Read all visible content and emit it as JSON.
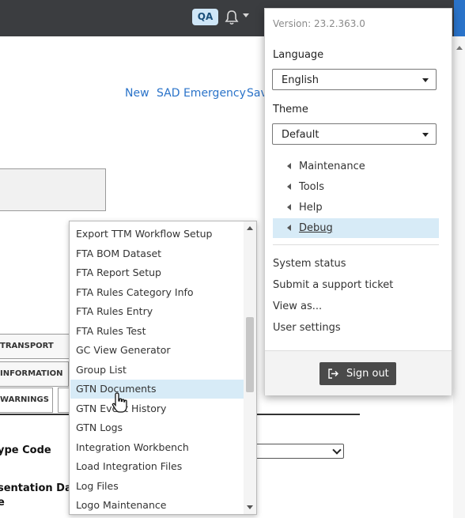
{
  "topbar": {
    "env_badge": "QA"
  },
  "actions": {
    "new": "New",
    "sad_emergency": "SAD Emergency",
    "save_partial": "Sav"
  },
  "background": {
    "tabs": [
      "TRANSPORT EQUIP",
      "INFORMATION",
      "WARNINGS"
    ],
    "type_code_label": "ype Code",
    "presentation_label_1": "sentation Dat",
    "presentation_label_2": "e"
  },
  "dropdown": {
    "items": [
      "Export TTM Workflow Setup",
      "FTA BOM Dataset",
      "FTA Report Setup",
      "FTA Rules Category Info",
      "FTA Rules Entry",
      "FTA Rules Test",
      "GC View Generator",
      "Group List",
      "GTN Documents",
      "GTN Event History",
      "GTN Logs",
      "Integration Workbench",
      "Load Integration Files",
      "Log Files",
      "Logo Maintenance"
    ],
    "selected": "GTN Documents"
  },
  "user_menu": {
    "version": "Version: 23.2.363.0",
    "language_label": "Language",
    "language_value": "English",
    "theme_label": "Theme",
    "theme_value": "Default",
    "submenus": [
      "Maintenance",
      "Tools",
      "Help",
      "Debug"
    ],
    "active_submenu": "Debug",
    "links": [
      "System status",
      "Submit a support ticket",
      "View as...",
      "User settings"
    ],
    "sign_out": "Sign out"
  }
}
